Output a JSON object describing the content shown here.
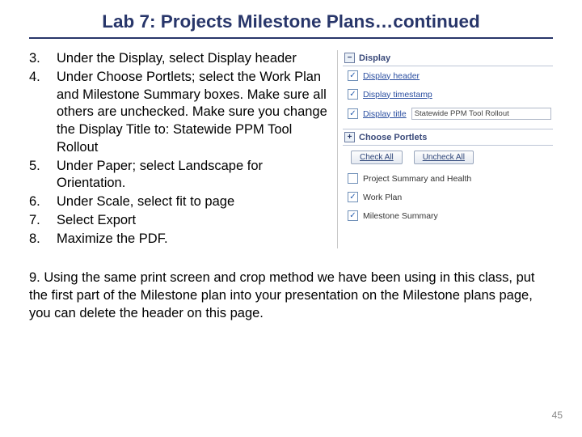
{
  "title": "Lab 7: Projects Milestone Plans…continued",
  "instructions": {
    "i3_num": "3.",
    "i3_text": "Under the Display, select Display header",
    "i4_num": "4.",
    "i4_text": "Under Choose Portlets; select the Work Plan and Milestone Summary boxes.  Make sure all others are unchecked.  Make sure you change the Display Title to:  Statewide PPM Tool Rollout",
    "i5_num": "5.",
    "i5_text": "Under Paper; select Landscape for Orientation.",
    "i6_num": "6.",
    "i6_text": "Under Scale, select fit to page",
    "i7_num": "7.",
    "i7_text": "Select Export",
    "i8_num": "8.",
    "i8_text": "Maximize the PDF."
  },
  "lower_text": "9.  Using the same print screen and crop method we have been using in this class, put the first part of the Milestone plan into your presentation on the Milestone plans page, you can delete the header on this page.",
  "page_number": "45",
  "panel": {
    "display_header": "Display",
    "opt_display_header": "Display header",
    "opt_display_timestamp": "Display timestamp",
    "opt_display_title": "Display title",
    "display_title_value": "Statewide PPM Tool Rollout",
    "choose_portlets_header": "Choose Portlets",
    "btn_check_all": "Check All",
    "btn_uncheck_all": "Uncheck All",
    "opt_project_summary": "Project Summary and Health",
    "opt_work_plan": "Work Plan",
    "opt_milestone_summary": "Milestone Summary"
  }
}
